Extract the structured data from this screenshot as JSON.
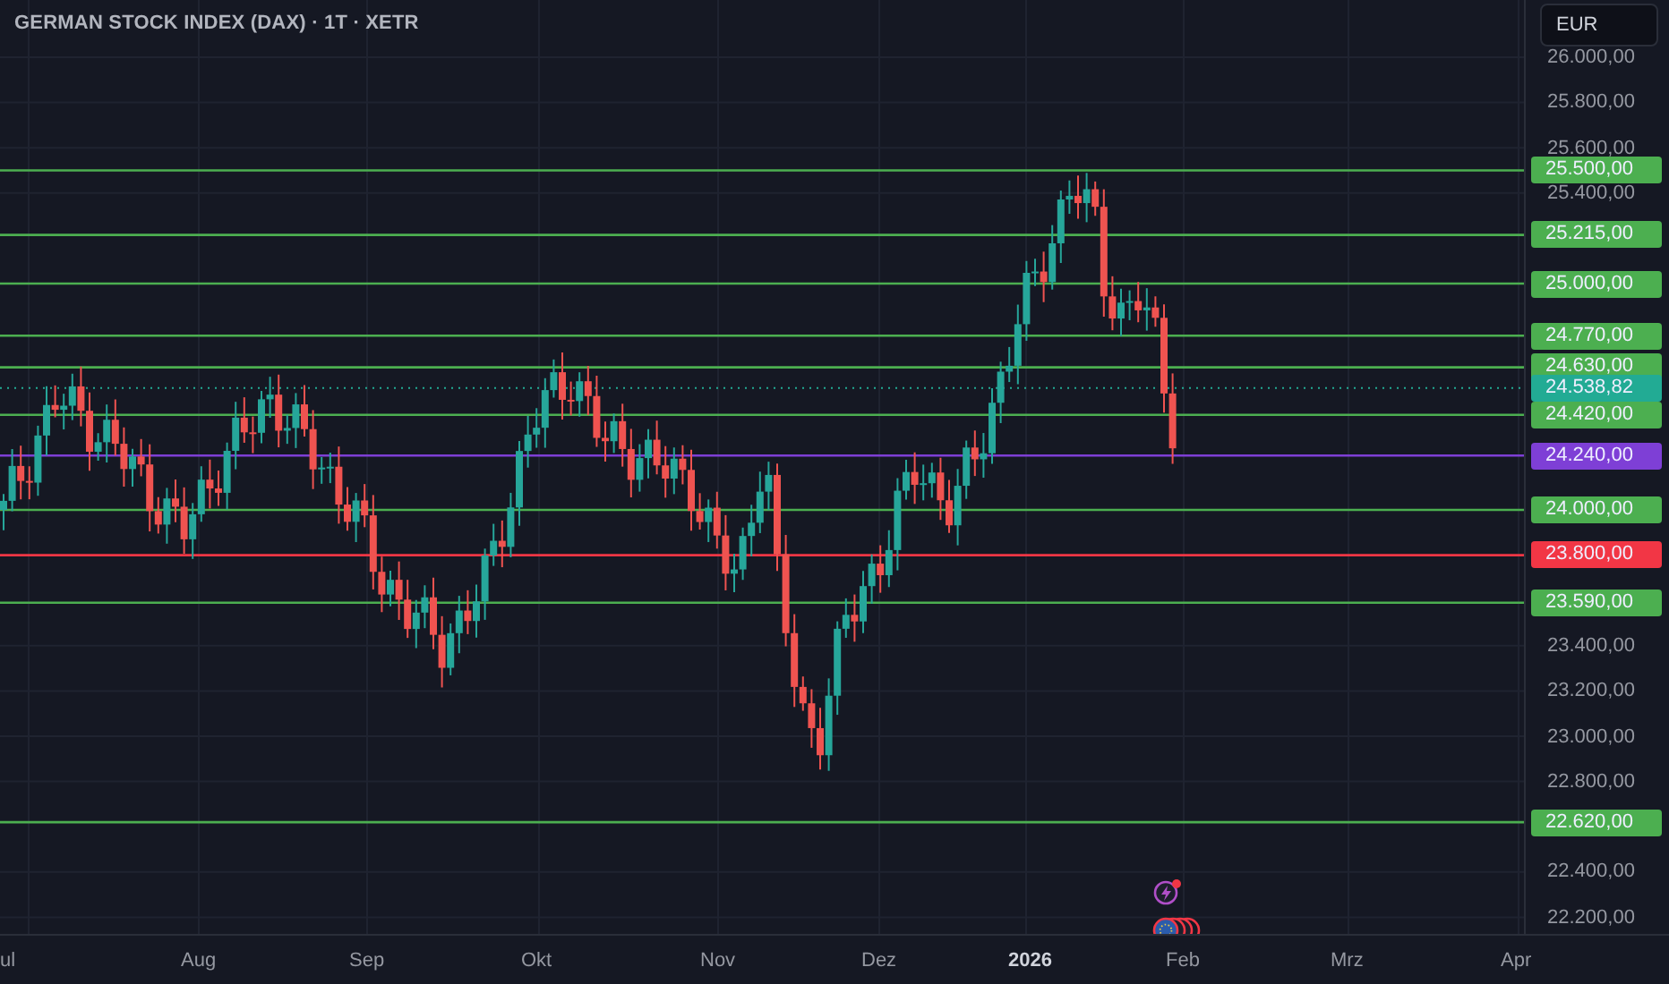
{
  "title": "GERMAN STOCK INDEX (DAX) · 1T · XETR",
  "currency": "EUR",
  "price_axis": [
    "26.000,00",
    "25.800,00",
    "25.600,00",
    "25.400,00",
    "23.400,00",
    "23.200,00",
    "23.000,00",
    "22.800,00",
    "22.400,00",
    "22.200,00"
  ],
  "time_axis": [
    {
      "label": "ul",
      "bold": false
    },
    {
      "label": "Aug",
      "bold": false
    },
    {
      "label": "Sep",
      "bold": false
    },
    {
      "label": "Okt",
      "bold": false
    },
    {
      "label": "Nov",
      "bold": false
    },
    {
      "label": "Dez",
      "bold": false
    },
    {
      "label": "2026",
      "bold": true
    },
    {
      "label": "Feb",
      "bold": false
    },
    {
      "label": "Mrz",
      "bold": false
    },
    {
      "label": "Apr",
      "bold": false
    }
  ],
  "levels": [
    {
      "label": "25.500,00",
      "color": "#4caf50",
      "kind": "level"
    },
    {
      "label": "25.215,00",
      "color": "#4caf50",
      "kind": "level"
    },
    {
      "label": "25.000,00",
      "color": "#4caf50",
      "kind": "level"
    },
    {
      "label": "24.770,00",
      "color": "#4caf50",
      "kind": "level"
    },
    {
      "label": "24.630,00",
      "color": "#4caf50",
      "kind": "level"
    },
    {
      "label": "24.538,82",
      "color": "#22ab94",
      "kind": "last-price"
    },
    {
      "label": "24.420,00",
      "color": "#4caf50",
      "kind": "level"
    },
    {
      "label": "24.240,00",
      "color": "#7e3fd6",
      "kind": "level"
    },
    {
      "label": "24.000,00",
      "color": "#4caf50",
      "kind": "level"
    },
    {
      "label": "23.800,00",
      "color": "#f23645",
      "kind": "level"
    },
    {
      "label": "23.590,00",
      "color": "#4caf50",
      "kind": "level"
    },
    {
      "label": "22.620,00",
      "color": "#4caf50",
      "kind": "level"
    }
  ]
}
